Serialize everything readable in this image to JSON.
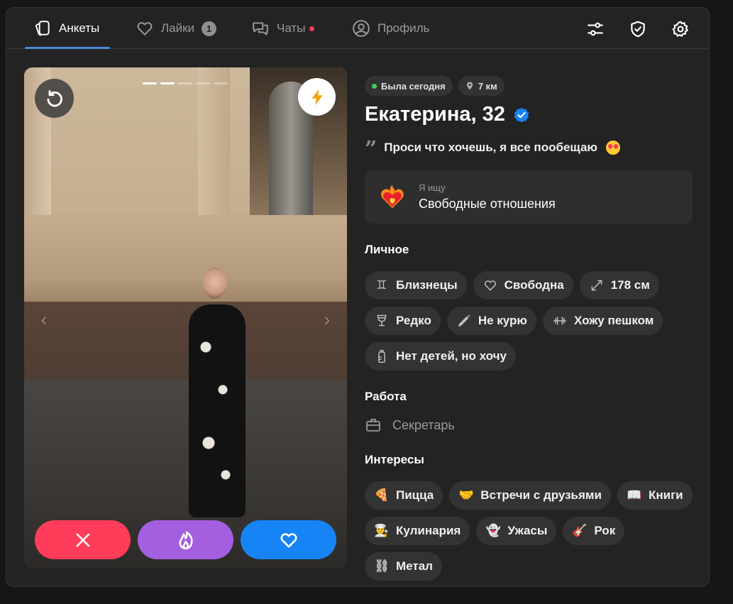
{
  "nav": {
    "tabs": [
      {
        "label": "Анкеты",
        "icon": "cards-icon",
        "active": true
      },
      {
        "label": "Лайки",
        "icon": "heart-icon",
        "badge": "1"
      },
      {
        "label": "Чаты",
        "icon": "chat-icon",
        "dot": true
      },
      {
        "label": "Профиль",
        "icon": "profile-icon"
      }
    ],
    "actions": [
      "filters-icon",
      "shield-check-icon",
      "settings-icon"
    ]
  },
  "photo": {
    "photo_count": 5,
    "current_index": 2,
    "buttons": [
      "rewind-icon",
      "boost-icon",
      "dislike-icon",
      "superlike-icon",
      "like-icon"
    ]
  },
  "profile": {
    "status": "Была сегодня",
    "distance": "7 км",
    "name": "Екатерина, 32",
    "verified": true,
    "quote": "Проси что хочешь, я все пообещаю",
    "seeking_label": "Я ищу",
    "seeking_value": "Свободные отношения"
  },
  "personal": {
    "title": "Личное",
    "chips": [
      {
        "label": "Близнецы",
        "icon": "gemini-icon"
      },
      {
        "label": "Свободна",
        "icon": "heart-outline-icon"
      },
      {
        "label": "178 см",
        "icon": "height-icon"
      },
      {
        "label": "Редко",
        "icon": "wine-glass-icon"
      },
      {
        "label": "Не курю",
        "icon": "no-smoking-icon"
      },
      {
        "label": "Хожу пешком",
        "icon": "dumbbell-icon"
      },
      {
        "label": "Нет детей, но хочу",
        "icon": "baby-bottle-icon"
      }
    ]
  },
  "work": {
    "title": "Работа",
    "value": "Секретарь",
    "icon": "briefcase-icon"
  },
  "interests": {
    "title": "Интересы",
    "chips": [
      {
        "label": "Пицца",
        "emoji": "🍕"
      },
      {
        "label": "Встречи с друзьями",
        "emoji": "🤝"
      },
      {
        "label": "Книги",
        "emoji": "📖"
      },
      {
        "label": "Кулинария",
        "emoji": "👨‍🍳"
      },
      {
        "label": "Ужасы",
        "emoji": "👻"
      },
      {
        "label": "Рок",
        "emoji": "🎸"
      },
      {
        "label": "Метал",
        "emoji": "⛓"
      }
    ]
  },
  "colors": {
    "accent_blue": "#1684f5",
    "dislike_red": "#ff3c59",
    "super_purple": "#a45fe0",
    "online_green": "#3ecf5a"
  }
}
